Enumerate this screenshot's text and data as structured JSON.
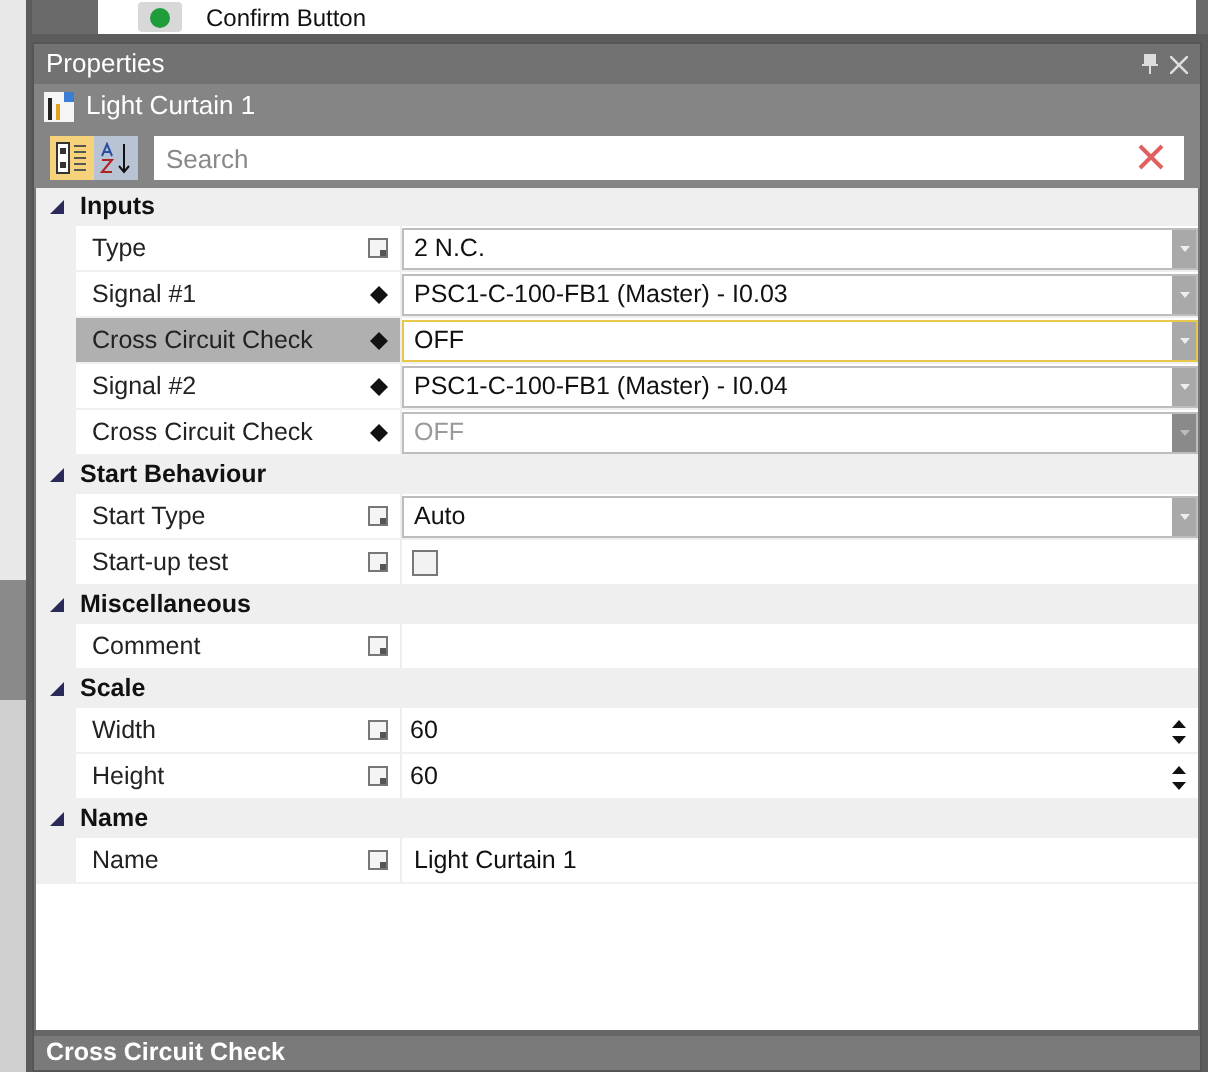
{
  "top_field": {
    "value": "Confirm Button"
  },
  "panel": {
    "title": "Properties"
  },
  "object": {
    "title": "Light Curtain 1"
  },
  "toolbar": {
    "categorized_selected": true,
    "alphabetical_selected": false
  },
  "search": {
    "placeholder": "Search"
  },
  "categories": [
    {
      "title": "Inputs",
      "expanded": true,
      "properties": [
        {
          "label": "Type",
          "marker": {
            "kind": "note"
          },
          "kind": "dropdown",
          "value": "2 N.C.",
          "selected": false,
          "disabled": false
        },
        {
          "label": "Signal #1",
          "marker": {
            "kind": "diamond"
          },
          "kind": "dropdown",
          "value": "PSC1-C-100-FB1 (Master) - I0.03",
          "selected": false,
          "disabled": false
        },
        {
          "label": "Cross Circuit Check",
          "kind": "dropdown",
          "value": "OFF",
          "selected": true,
          "marker": {
            "kind": "diamond"
          },
          "disabled": false
        },
        {
          "label": "Signal #2",
          "marker": {
            "kind": "diamond"
          },
          "kind": "dropdown",
          "value": "PSC1-C-100-FB1 (Master) - I0.04",
          "selected": false,
          "disabled": false
        },
        {
          "label": "Cross Circuit Check",
          "marker": {
            "kind": "diamond"
          },
          "kind": "dropdown",
          "value": "OFF",
          "selected": false,
          "disabled": true
        }
      ]
    },
    {
      "title": "Start Behaviour",
      "expanded": true,
      "properties": [
        {
          "label": "Start Type",
          "marker": {
            "kind": "note"
          },
          "kind": "dropdown",
          "value": "Auto",
          "selected": false,
          "disabled": false
        },
        {
          "label": "Start-up test",
          "marker": {
            "kind": "note"
          },
          "kind": "checkbox",
          "checked": false,
          "selected": false,
          "disabled": false
        }
      ]
    },
    {
      "title": "Miscellaneous",
      "expanded": true,
      "properties": [
        {
          "label": "Comment",
          "marker": {
            "kind": "note"
          },
          "kind": "text",
          "selected": false,
          "disabled": false
        }
      ]
    },
    {
      "title": "Scale",
      "expanded": true,
      "properties": [
        {
          "label": "Width",
          "marker": {
            "kind": "note"
          },
          "kind": "spinner",
          "value": "60",
          "selected": false,
          "disabled": false
        },
        {
          "label": "Height",
          "marker": {
            "kind": "note"
          },
          "kind": "spinner",
          "value": "60",
          "selected": false,
          "disabled": false
        }
      ]
    },
    {
      "title": "Name",
      "expanded": true,
      "properties": [
        {
          "label": "Name",
          "marker": {
            "kind": "note"
          },
          "kind": "text",
          "value": "Light Curtain 1",
          "selected": false,
          "disabled": false
        }
      ]
    }
  ],
  "description": {
    "title": "Cross Circuit Check"
  }
}
